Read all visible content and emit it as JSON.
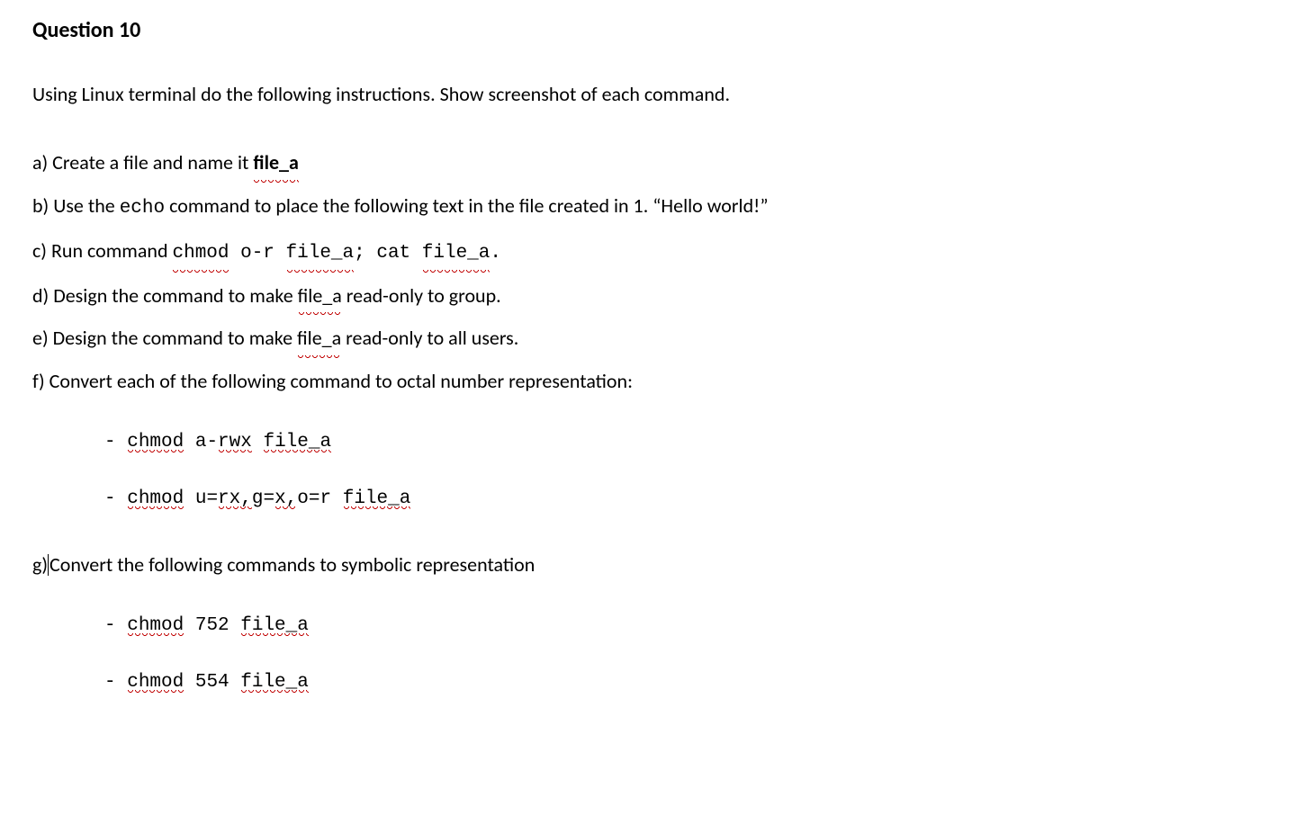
{
  "heading": "Question 10",
  "intro": "Using Linux terminal do the following instructions. Show screenshot of each command.",
  "a": {
    "prefix": "a) Create a file and name it ",
    "file": "file_a"
  },
  "b": {
    "p1": "b) Use the ",
    "echo": "echo",
    "p2": "  command to place the following text in the file created in 1. “Hello world!”"
  },
  "c": {
    "p1": "c) Run command ",
    "c1": "chmod",
    "c2": " o-r ",
    "c3": "file_a",
    "c4": ";  cat ",
    "c5": "file_a",
    "c6": "."
  },
  "d": {
    "p1": "d) Design the command to make ",
    "file": "file_a",
    "p2": " read-only to group."
  },
  "e": {
    "p1": "e) Design the command to make ",
    "file": "file_a",
    "p2": " read-only to all users."
  },
  "f": {
    "text": "f) Convert each of the following command to octal number representation:",
    "item1": {
      "dash": "- ",
      "c1": "chmod",
      "c2": " a-",
      "c3": "rwx",
      "c4": " ",
      "c5": "file_a"
    },
    "item2": {
      "dash": "- ",
      "c1": "chmod",
      "c2": " u=",
      "c3": "rx,",
      "c4": "g=",
      "c5": "x,",
      "c6": "o=r ",
      "c7": "file_a"
    }
  },
  "g": {
    "label": "g)",
    "text": "Convert the following commands to symbolic representation",
    "item1": {
      "dash": "-  ",
      "c1": "chmod",
      "c2": " 752 ",
      "c3": "file_a"
    },
    "item2": {
      "dash": "-  ",
      "c1": "chmod",
      "c2": " 554 ",
      "c3": "file_a"
    }
  }
}
